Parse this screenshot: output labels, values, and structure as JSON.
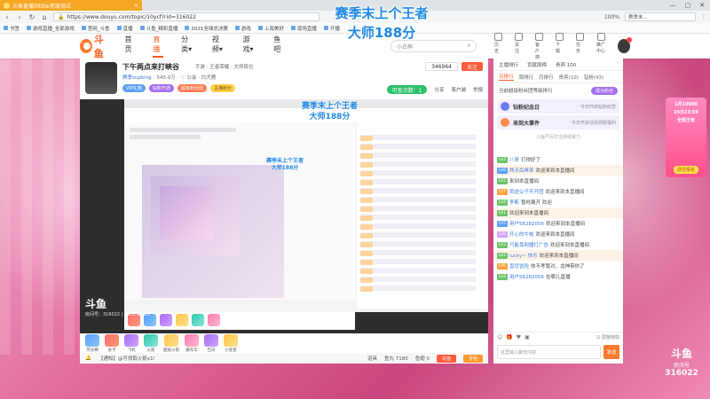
{
  "browser": {
    "tab_title": "斗鱼直播间title宽度测试",
    "tab_close": "×",
    "url": "https://www.douyu.com/topic/10ycf?rid=316022",
    "zoom": "100%",
    "search_text": "赛季末...",
    "bookmarks": [
      "书签",
      "游戏直播_全部游戏",
      "官网_斗鱼",
      "直播",
      "斗鱼_精彩直播",
      "2021全球总决赛",
      "游戏",
      "上海美好",
      "现场直播",
      "开播"
    ],
    "window_controls": [
      "—",
      "▢",
      "✕"
    ]
  },
  "overlay": {
    "line1": "赛季末上个王者",
    "line2": "大师188分"
  },
  "site": {
    "logo_text": "斗鱼",
    "nav": [
      "首页",
      "直播",
      "分类▾",
      "视频▾",
      "游戏▾",
      "鱼吧"
    ],
    "active_nav": "直播",
    "search_placeholder": "小白熊",
    "header_icons": [
      "历史",
      "关注",
      "客户端",
      "下载",
      "任务",
      "推广中心"
    ]
  },
  "room": {
    "title": "下午两点来打峡谷",
    "meta": "手游 · 王者荣耀 · 大师段位",
    "anchor": "赛季supking",
    "hot": "545.0万",
    "extra": "♡ 公会 · 白犬鹿",
    "fan_count": "346964",
    "follow_label": "关注",
    "badges": [
      "VIP礼物",
      "钻粉开通",
      "超级粉丝团",
      "主播积分"
    ],
    "gift_badge": "可查次数：1",
    "actions": [
      "分享",
      "客户端",
      "举报"
    ]
  },
  "player": {
    "inner_line1": "赛季末上个王者",
    "inner_line2": "大师188分",
    "watermark_logo": "斗鱼",
    "watermark_room": "房间号：316022 | 2022.12.18",
    "gifts": [
      "荧光棒",
      "办卡",
      "飞机",
      "火箭",
      "超级火箭",
      "嘉年华",
      "告白",
      "小星星"
    ],
    "notice": "【通知】@可领取火箭x1!",
    "bottom_right": [
      "道具",
      "鱼丸 7180",
      "鱼翅 0"
    ],
    "recharge_label": "充值",
    "bag_label": "背包"
  },
  "chat": {
    "top_items": [
      "主播排行",
      "贡献周榜",
      "贵宾 100"
    ],
    "tabs": [
      "日排行",
      "周排行",
      "月排行",
      "贵宾(10)",
      "钻粉(43)"
    ],
    "fans_text": "当前超级粉丝团等级排行",
    "fans_button": "成为粉丝",
    "notice1_title": "钻粉纪念日",
    "notice1_sub": "今日开启钻粉纪念",
    "notice2_title": "来到大事件",
    "notice2_sub": "今日开启活动领取福利",
    "sys_text": "斗鱼严厉打击网络暴力",
    "messages": [
      {
        "lv": "LV3",
        "cls": "lv-g",
        "user": "八哥",
        "text": "打得好了"
      },
      {
        "lv": "LV6",
        "cls": "lv-b",
        "user": "两天后再来",
        "text": "欢迎来到本直播间"
      },
      {
        "lv": "LV2",
        "cls": "lv-g",
        "user": "",
        "text": "来到本直播间"
      },
      {
        "lv": "LV7",
        "cls": "lv-o",
        "user": "雨途公子不开团",
        "text": "欢迎来到本直播间"
      },
      {
        "lv": "LV4",
        "cls": "lv-g",
        "user": "李斯",
        "text": "暂时离开 欢迎"
      },
      {
        "lv": "LV1",
        "cls": "lv-g",
        "user": "",
        "text": "欢迎来到本直播间"
      },
      {
        "lv": "LV5",
        "cls": "lv-b",
        "user": "用户56282056",
        "text": "欢迎来到本直播间"
      },
      {
        "lv": "LV8",
        "cls": "lv-p",
        "user": "开心的牛蛙",
        "text": "欢迎来到本直播间"
      },
      {
        "lv": "LV3",
        "cls": "lv-g",
        "user": "只能靠网盟打广告",
        "text": "欢迎来到本直播间"
      },
      {
        "lv": "LV2",
        "cls": "lv-g",
        "user": "lucky~ 快乐",
        "text": "欢迎来到本直播间"
      },
      {
        "lv": "LV6",
        "cls": "lv-o",
        "user": "直尽冒险",
        "text": "你不考我对，龙神带你了"
      },
      {
        "lv": "LV4",
        "cls": "lv-g",
        "user": "用户56282056",
        "text": "在哪儿直播"
      }
    ],
    "tools_right": "☑ 屏蔽特效",
    "input_placeholder": "这里输入聊天内容",
    "send_label": "发送"
  },
  "side": {
    "ad_line1": "1月10000",
    "ad_line2": "24日23:59",
    "ad_line3": "全服王者",
    "ad_button": "前往报名",
    "room_logo": "斗鱼",
    "room_label": "房间号",
    "room_id": "316022"
  }
}
